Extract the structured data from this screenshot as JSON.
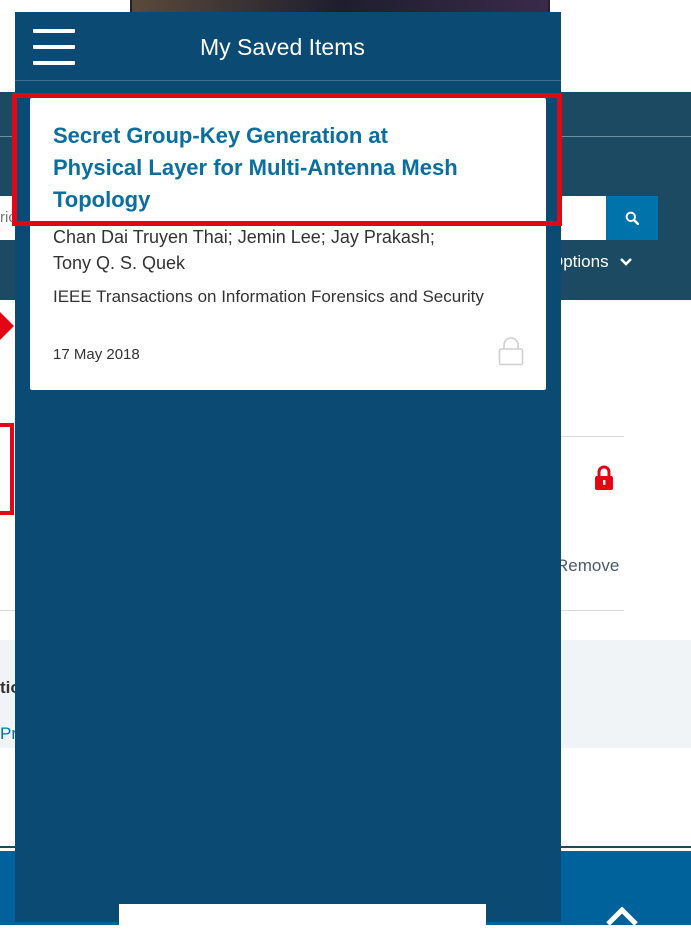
{
  "drawer": {
    "title": "My Saved Items",
    "menu_icon": "hamburger-menu-icon"
  },
  "saved_item": {
    "title": "Secret Group-Key Generation at Physical Layer for Multi-Antenna Mesh Topology",
    "authors": "Chan Dai Truyen Thai; Jemin Lee; Jay Prakash; Tony Q. S. Quek",
    "publication": "IEEE Transactions on Information Forensics and Security",
    "date": "17 May 2018",
    "access_icon": "lock-open-icon"
  },
  "background": {
    "options_label": "Options",
    "remove_label": "Remove",
    "search_icon": "search-icon",
    "lock_icon": "lock-closed-icon",
    "left_text_1": "tio",
    "left_text_2": "Pr",
    "search_left_text": "ric"
  },
  "colors": {
    "drawer_bg": "#0b4a72",
    "title_link": "#0a6e9e",
    "highlight": "#e30613",
    "header_bg": "#1c4a63"
  }
}
